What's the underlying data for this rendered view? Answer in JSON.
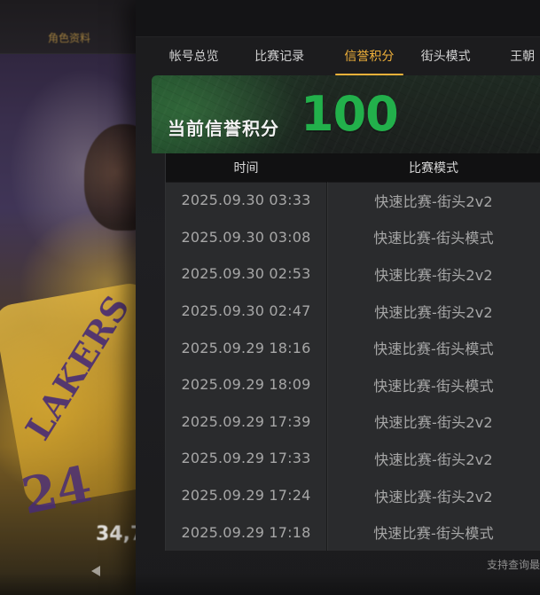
{
  "tabs": [
    {
      "label": "帐号总览"
    },
    {
      "label": "比赛记录"
    },
    {
      "label": "信誉积分"
    },
    {
      "label": "街头模式"
    },
    {
      "label": "王朝"
    }
  ],
  "active_tab_index": 2,
  "credit": {
    "label": "当前信誉积分",
    "value": "100"
  },
  "table": {
    "headers": {
      "time": "时间",
      "mode": "比赛模式"
    },
    "rows": [
      {
        "time": "2025.09.30  03:33",
        "mode": "快速比赛-街头2v2"
      },
      {
        "time": "2025.09.30  03:08",
        "mode": "快速比赛-街头模式"
      },
      {
        "time": "2025.09.30  02:53",
        "mode": "快速比赛-街头2v2"
      },
      {
        "time": "2025.09.30  02:47",
        "mode": "快速比赛-街头2v2"
      },
      {
        "time": "2025.09.29  18:16",
        "mode": "快速比赛-街头模式"
      },
      {
        "time": "2025.09.29  18:09",
        "mode": "快速比赛-街头模式"
      },
      {
        "time": "2025.09.29  17:39",
        "mode": "快速比赛-街头2v2"
      },
      {
        "time": "2025.09.29  17:33",
        "mode": "快速比赛-街头2v2"
      },
      {
        "time": "2025.09.29  17:24",
        "mode": "快速比赛-街头2v2"
      },
      {
        "time": "2025.09.29  17:18",
        "mode": "快速比赛-街头模式"
      }
    ]
  },
  "footer_note": "支持查询最",
  "background_card": {
    "top_label": "角色资料",
    "jersey_text": "LAKERS",
    "jersey_number": "24",
    "bottom_value": "34,7"
  },
  "colors": {
    "accent_gold": "#f0b13a",
    "credit_green": "#22b04b",
    "panel_bg": "#1f1f22",
    "table_bg": "#2a2b2d",
    "table_header_bg": "#111112",
    "text_main": "#d1d1d1",
    "text_muted": "#a7a7a7"
  },
  "icons": {
    "left_arrow": "left-arrow-icon"
  }
}
